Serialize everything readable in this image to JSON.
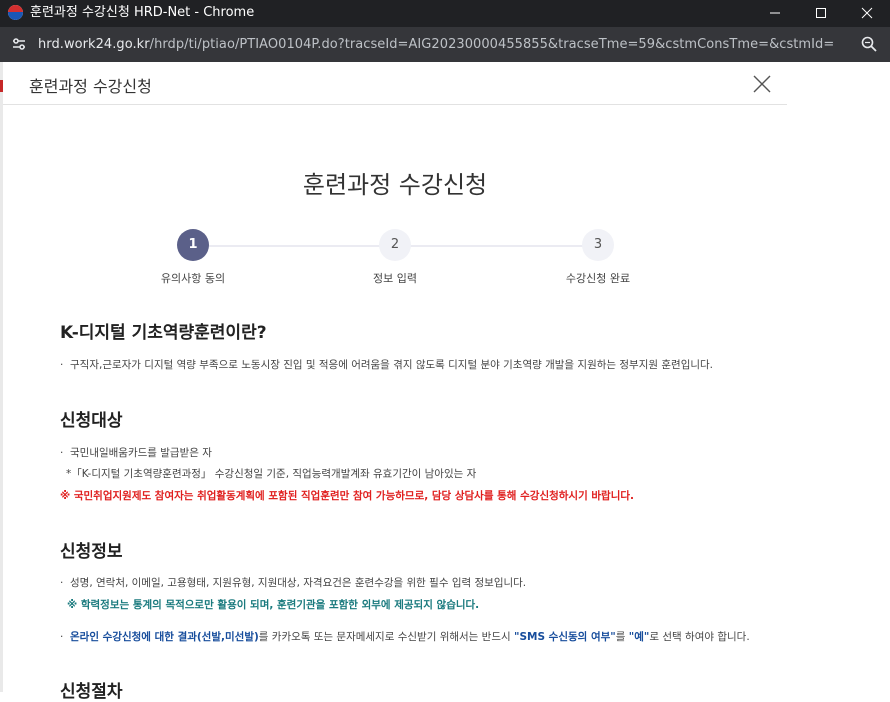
{
  "window": {
    "title": "훈련과정 수강신청 HRD-Net - Chrome"
  },
  "address_bar": {
    "host": "hrd.work24.go.kr",
    "path": "/hrdp/ti/ptiao/PTIAO0104P.do?tracseId=AIG20230000455855&tracseTme=59&cstmConsTme=&cstmId="
  },
  "modal": {
    "header_title": "훈련과정 수강신청",
    "main_title": "훈련과정 수강신청"
  },
  "steps": [
    {
      "num": "1",
      "label": "유의사항 동의",
      "active": true
    },
    {
      "num": "2",
      "label": "정보 입력",
      "active": false
    },
    {
      "num": "3",
      "label": "수강신청 완료",
      "active": false
    }
  ],
  "sections": {
    "intro": {
      "heading": "K-디지털 기초역량훈련이란?",
      "text": "구직자,근로자가 디지털 역량 부족으로 노동시장 진입 및 적응에 어려움을 겪지 않도록 디지털 분야 기초역량 개발을 지원하는 정부지원 훈련입니다."
    },
    "target": {
      "heading": "신청대상",
      "line1": "국민내일배움카드를 발급받은 자",
      "line2": "*「K-디지털 기초역량훈련과정」 수강신청일 기준, 직업능력개발계좌 유효기간이 남아있는 자",
      "warning": "※ 국민취업지원제도 참여자는 취업활동계획에 포함된 직업훈련만 참여 가능하므로, 담당 상담사를 통해 수강신청하시기 바랍니다."
    },
    "info": {
      "heading": "신청정보",
      "line1": "성명, 연락처, 이메일, 고용형태, 지원유형, 지원대상, 자격요건은 훈련수강을 위한 필수 입력 정보입니다.",
      "note": "※ 학력정보는 통계의 목적으로만 활용이 되며, 훈련기관을 포함한 외부에 제공되지 않습니다.",
      "line2_a": "온라인 수강신청에 대한 결과(선발,미선발)",
      "line2_b": "를 카카오톡 또는 문자메세지로 수신받기 위해서는 반드시 ",
      "line2_c": "\"SMS 수신동의 여부\"",
      "line2_d": "를 ",
      "line2_e": "\"예\"",
      "line2_f": "로 선택 하여야 합니다."
    },
    "procedure": {
      "heading": "신청절차"
    }
  }
}
